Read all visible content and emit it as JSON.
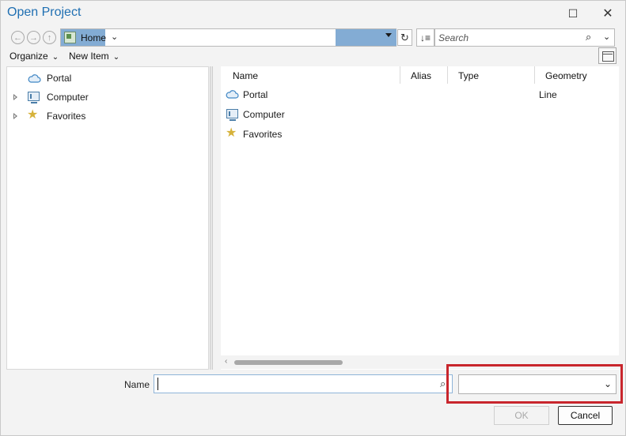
{
  "window": {
    "title": "Open Project",
    "maximize_glyph": "☐",
    "close_glyph": "✕"
  },
  "navigation": {
    "back_glyph": "←",
    "forward_glyph": "→",
    "up_glyph": "↑",
    "address_text": "Home",
    "address_chevron": "⌄",
    "refresh_glyph": "↻",
    "sort_glyph": "↓≡"
  },
  "search": {
    "placeholder": "Search",
    "icon": "⌕",
    "dropdown_glyph": "⌄"
  },
  "toolbar": {
    "organize_label": "Organize",
    "new_item_label": "New Item",
    "chevron": "⌄"
  },
  "tree": {
    "items": [
      {
        "label": "Portal",
        "icon": "cloud-icon",
        "expandable": false
      },
      {
        "label": "Computer",
        "icon": "computer-icon",
        "expandable": true
      },
      {
        "label": "Favorites",
        "icon": "star-icon",
        "expandable": true
      }
    ]
  },
  "content": {
    "columns": [
      "Name",
      "Alias",
      "Type",
      "Geometry"
    ],
    "rows": [
      {
        "name": "Portal",
        "icon": "cloud-icon",
        "geometry": "Line"
      },
      {
        "name": "Computer",
        "icon": "computer-icon",
        "geometry": ""
      },
      {
        "name": "Favorites",
        "icon": "star-icon",
        "geometry": ""
      }
    ],
    "scroll_left_glyph": "‹"
  },
  "footer": {
    "name_label": "Name",
    "name_value": "",
    "name_search_icon": "⌕",
    "type_value": "",
    "type_chevron": "⌄",
    "ok_label": "OK",
    "cancel_label": "Cancel",
    "highlight_color": "#c8262d"
  },
  "colors": {
    "title": "#1f6fb2",
    "selection": "#83acd4",
    "star": "#d6b23a",
    "computer": "#4a7da8"
  }
}
